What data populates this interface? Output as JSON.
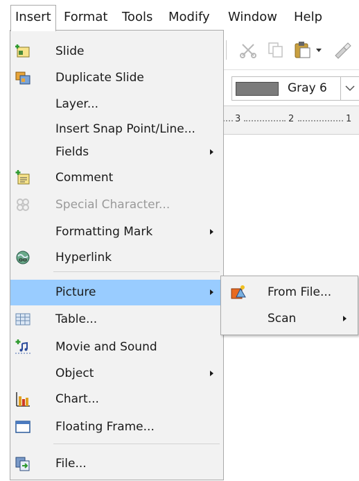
{
  "menubar": {
    "items": [
      {
        "label": "Insert"
      },
      {
        "label": "Format"
      },
      {
        "label": "Tools"
      },
      {
        "label": "Modify"
      },
      {
        "label": "Window"
      },
      {
        "label": "Help"
      }
    ]
  },
  "toolbar": {
    "fill_color_name": "Gray 6",
    "ruler_ticks": [
      "3",
      "2",
      "1"
    ]
  },
  "insert_menu": {
    "items": [
      {
        "label": "Slide",
        "icon": "slide-icon"
      },
      {
        "label": "Duplicate Slide",
        "icon": "duplicate-slide-icon"
      },
      {
        "label": "Layer..."
      },
      {
        "label": "Insert Snap Point/Line..."
      },
      {
        "label": "Fields"
      },
      {
        "label": "Comment",
        "icon": "comment-icon"
      },
      {
        "label": "Special Character...",
        "icon": "special-character-icon",
        "disabled": true
      },
      {
        "label": "Formatting Mark"
      },
      {
        "label": "Hyperlink",
        "icon": "hyperlink-icon"
      },
      {
        "label": "Picture",
        "selected": true
      },
      {
        "label": "Table...",
        "icon": "table-icon"
      },
      {
        "label": "Movie and Sound",
        "icon": "movie-sound-icon"
      },
      {
        "label": "Object"
      },
      {
        "label": "Chart...",
        "icon": "chart-icon"
      },
      {
        "label": "Floating Frame...",
        "icon": "floating-frame-icon"
      },
      {
        "label": "File...",
        "icon": "file-icon"
      }
    ]
  },
  "picture_menu": {
    "items": [
      {
        "label": "From File...",
        "icon": "image-from-file-icon"
      },
      {
        "label": "Scan"
      }
    ]
  },
  "colors": {
    "menu_bg": "#f2f2f2",
    "highlight": "#99ccff",
    "disabled_text": "#9a9a9a"
  }
}
